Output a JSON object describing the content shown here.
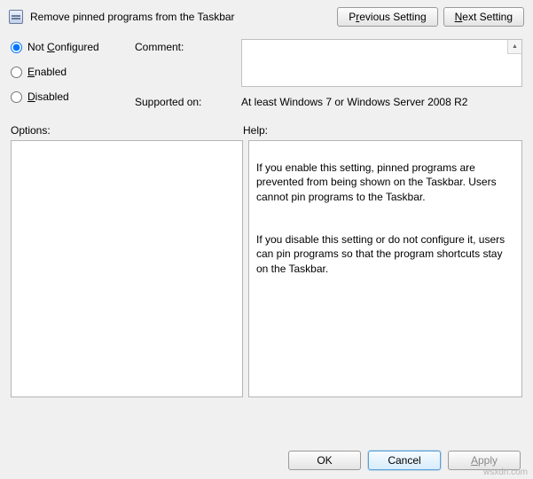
{
  "header": {
    "title": "Remove pinned programs from the Taskbar",
    "prev_label_pre": "P",
    "prev_label_u": "r",
    "prev_label_post": "evious Setting",
    "next_label_pre": "",
    "next_label_u": "N",
    "next_label_post": "ext Setting"
  },
  "radios": {
    "not_configured_pre": "Not ",
    "not_configured_u": "C",
    "not_configured_post": "onfigured",
    "enabled_pre": "",
    "enabled_u": "E",
    "enabled_post": "nabled",
    "disabled_pre": "",
    "disabled_u": "D",
    "disabled_post": "isabled",
    "selected": "not_configured"
  },
  "labels": {
    "comment": "Comment:",
    "supported_on": "Supported on:",
    "options": "Options:",
    "help": "Help:"
  },
  "supported_value": "At least Windows 7 or Windows Server 2008 R2",
  "comment_value": "",
  "options_value": "",
  "help_text": "If you enable this setting, pinned programs are prevented from being shown on the Taskbar. Users cannot pin programs to the Taskbar.\n\n\nIf you disable this setting or do not configure it, users can pin programs so that the program shortcuts stay on the Taskbar.",
  "footer": {
    "ok": "OK",
    "cancel": "Cancel",
    "apply_pre": "",
    "apply_u": "A",
    "apply_post": "pply"
  },
  "watermark": "wsxdn.com"
}
